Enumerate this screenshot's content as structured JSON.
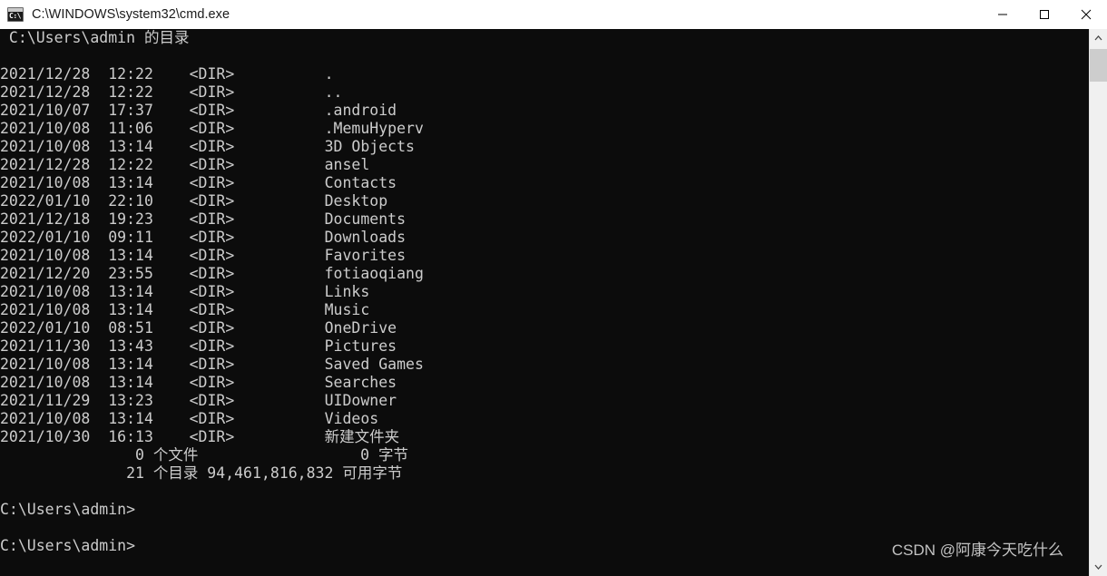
{
  "window": {
    "title": "C:\\WINDOWS\\system32\\cmd.exe",
    "icon": "cmd-console-icon",
    "icon_glyph": "C:\\",
    "titlebar_bg": "#ffffff",
    "terminal_bg": "#0c0c0c",
    "terminal_fg": "#cccccc"
  },
  "controls": {
    "minimize_label": "Minimize",
    "maximize_label": "Maximize",
    "close_label": "Close"
  },
  "scrollbar": {
    "up_arrow": "scroll-up-arrow",
    "down_arrow": "scroll-down-arrow",
    "thumb": "scroll-thumb"
  },
  "console": {
    "directory_header": " C:\\Users\\admin 的目录",
    "entries": [
      {
        "date": "2021/12/28",
        "time": "12:22",
        "type": "<DIR>",
        "name": "."
      },
      {
        "date": "2021/12/28",
        "time": "12:22",
        "type": "<DIR>",
        "name": ".."
      },
      {
        "date": "2021/10/07",
        "time": "17:37",
        "type": "<DIR>",
        "name": ".android"
      },
      {
        "date": "2021/10/08",
        "time": "11:06",
        "type": "<DIR>",
        "name": ".MemuHyperv"
      },
      {
        "date": "2021/10/08",
        "time": "13:14",
        "type": "<DIR>",
        "name": "3D Objects"
      },
      {
        "date": "2021/12/28",
        "time": "12:22",
        "type": "<DIR>",
        "name": "ansel"
      },
      {
        "date": "2021/10/08",
        "time": "13:14",
        "type": "<DIR>",
        "name": "Contacts"
      },
      {
        "date": "2022/01/10",
        "time": "22:10",
        "type": "<DIR>",
        "name": "Desktop"
      },
      {
        "date": "2021/12/18",
        "time": "19:23",
        "type": "<DIR>",
        "name": "Documents"
      },
      {
        "date": "2022/01/10",
        "time": "09:11",
        "type": "<DIR>",
        "name": "Downloads"
      },
      {
        "date": "2021/10/08",
        "time": "13:14",
        "type": "<DIR>",
        "name": "Favorites"
      },
      {
        "date": "2021/12/20",
        "time": "23:55",
        "type": "<DIR>",
        "name": "fotiaoqiang"
      },
      {
        "date": "2021/10/08",
        "time": "13:14",
        "type": "<DIR>",
        "name": "Links"
      },
      {
        "date": "2021/10/08",
        "time": "13:14",
        "type": "<DIR>",
        "name": "Music"
      },
      {
        "date": "2022/01/10",
        "time": "08:51",
        "type": "<DIR>",
        "name": "OneDrive"
      },
      {
        "date": "2021/11/30",
        "time": "13:43",
        "type": "<DIR>",
        "name": "Pictures"
      },
      {
        "date": "2021/10/08",
        "time": "13:14",
        "type": "<DIR>",
        "name": "Saved Games"
      },
      {
        "date": "2021/10/08",
        "time": "13:14",
        "type": "<DIR>",
        "name": "Searches"
      },
      {
        "date": "2021/11/29",
        "time": "13:23",
        "type": "<DIR>",
        "name": "UIDowner"
      },
      {
        "date": "2021/10/08",
        "time": "13:14",
        "type": "<DIR>",
        "name": "Videos"
      },
      {
        "date": "2021/10/30",
        "time": "16:13",
        "type": "<DIR>",
        "name": "新建文件夹"
      }
    ],
    "summary_files": "               0 个文件                  0 字节",
    "summary_dirs": "              21 个目录 94,461,816,832 可用字节",
    "prompt_1": "C:\\Users\\admin>",
    "prompt_2": "C:\\Users\\admin>",
    "full_text": " C:\\Users\\admin 的目录\n\n2021/12/28  12:22    <DIR>          .\n2021/12/28  12:22    <DIR>          ..\n2021/10/07  17:37    <DIR>          .android\n2021/10/08  11:06    <DIR>          .MemuHyperv\n2021/10/08  13:14    <DIR>          3D Objects\n2021/12/28  12:22    <DIR>          ansel\n2021/10/08  13:14    <DIR>          Contacts\n2022/01/10  22:10    <DIR>          Desktop\n2021/12/18  19:23    <DIR>          Documents\n2022/01/10  09:11    <DIR>          Downloads\n2021/10/08  13:14    <DIR>          Favorites\n2021/12/20  23:55    <DIR>          fotiaoqiang\n2021/10/08  13:14    <DIR>          Links\n2021/10/08  13:14    <DIR>          Music\n2022/01/10  08:51    <DIR>          OneDrive\n2021/11/30  13:43    <DIR>          Pictures\n2021/10/08  13:14    <DIR>          Saved Games\n2021/10/08  13:14    <DIR>          Searches\n2021/11/29  13:23    <DIR>          UIDowner\n2021/10/08  13:14    <DIR>          Videos\n2021/10/30  16:13    <DIR>          新建文件夹\n               0 个文件                  0 字节\n              21 个目录 94,461,816,832 可用字节\n\nC:\\Users\\admin>\n\nC:\\Users\\admin>"
  },
  "watermark": {
    "text": "CSDN @阿康今天吃什么"
  }
}
